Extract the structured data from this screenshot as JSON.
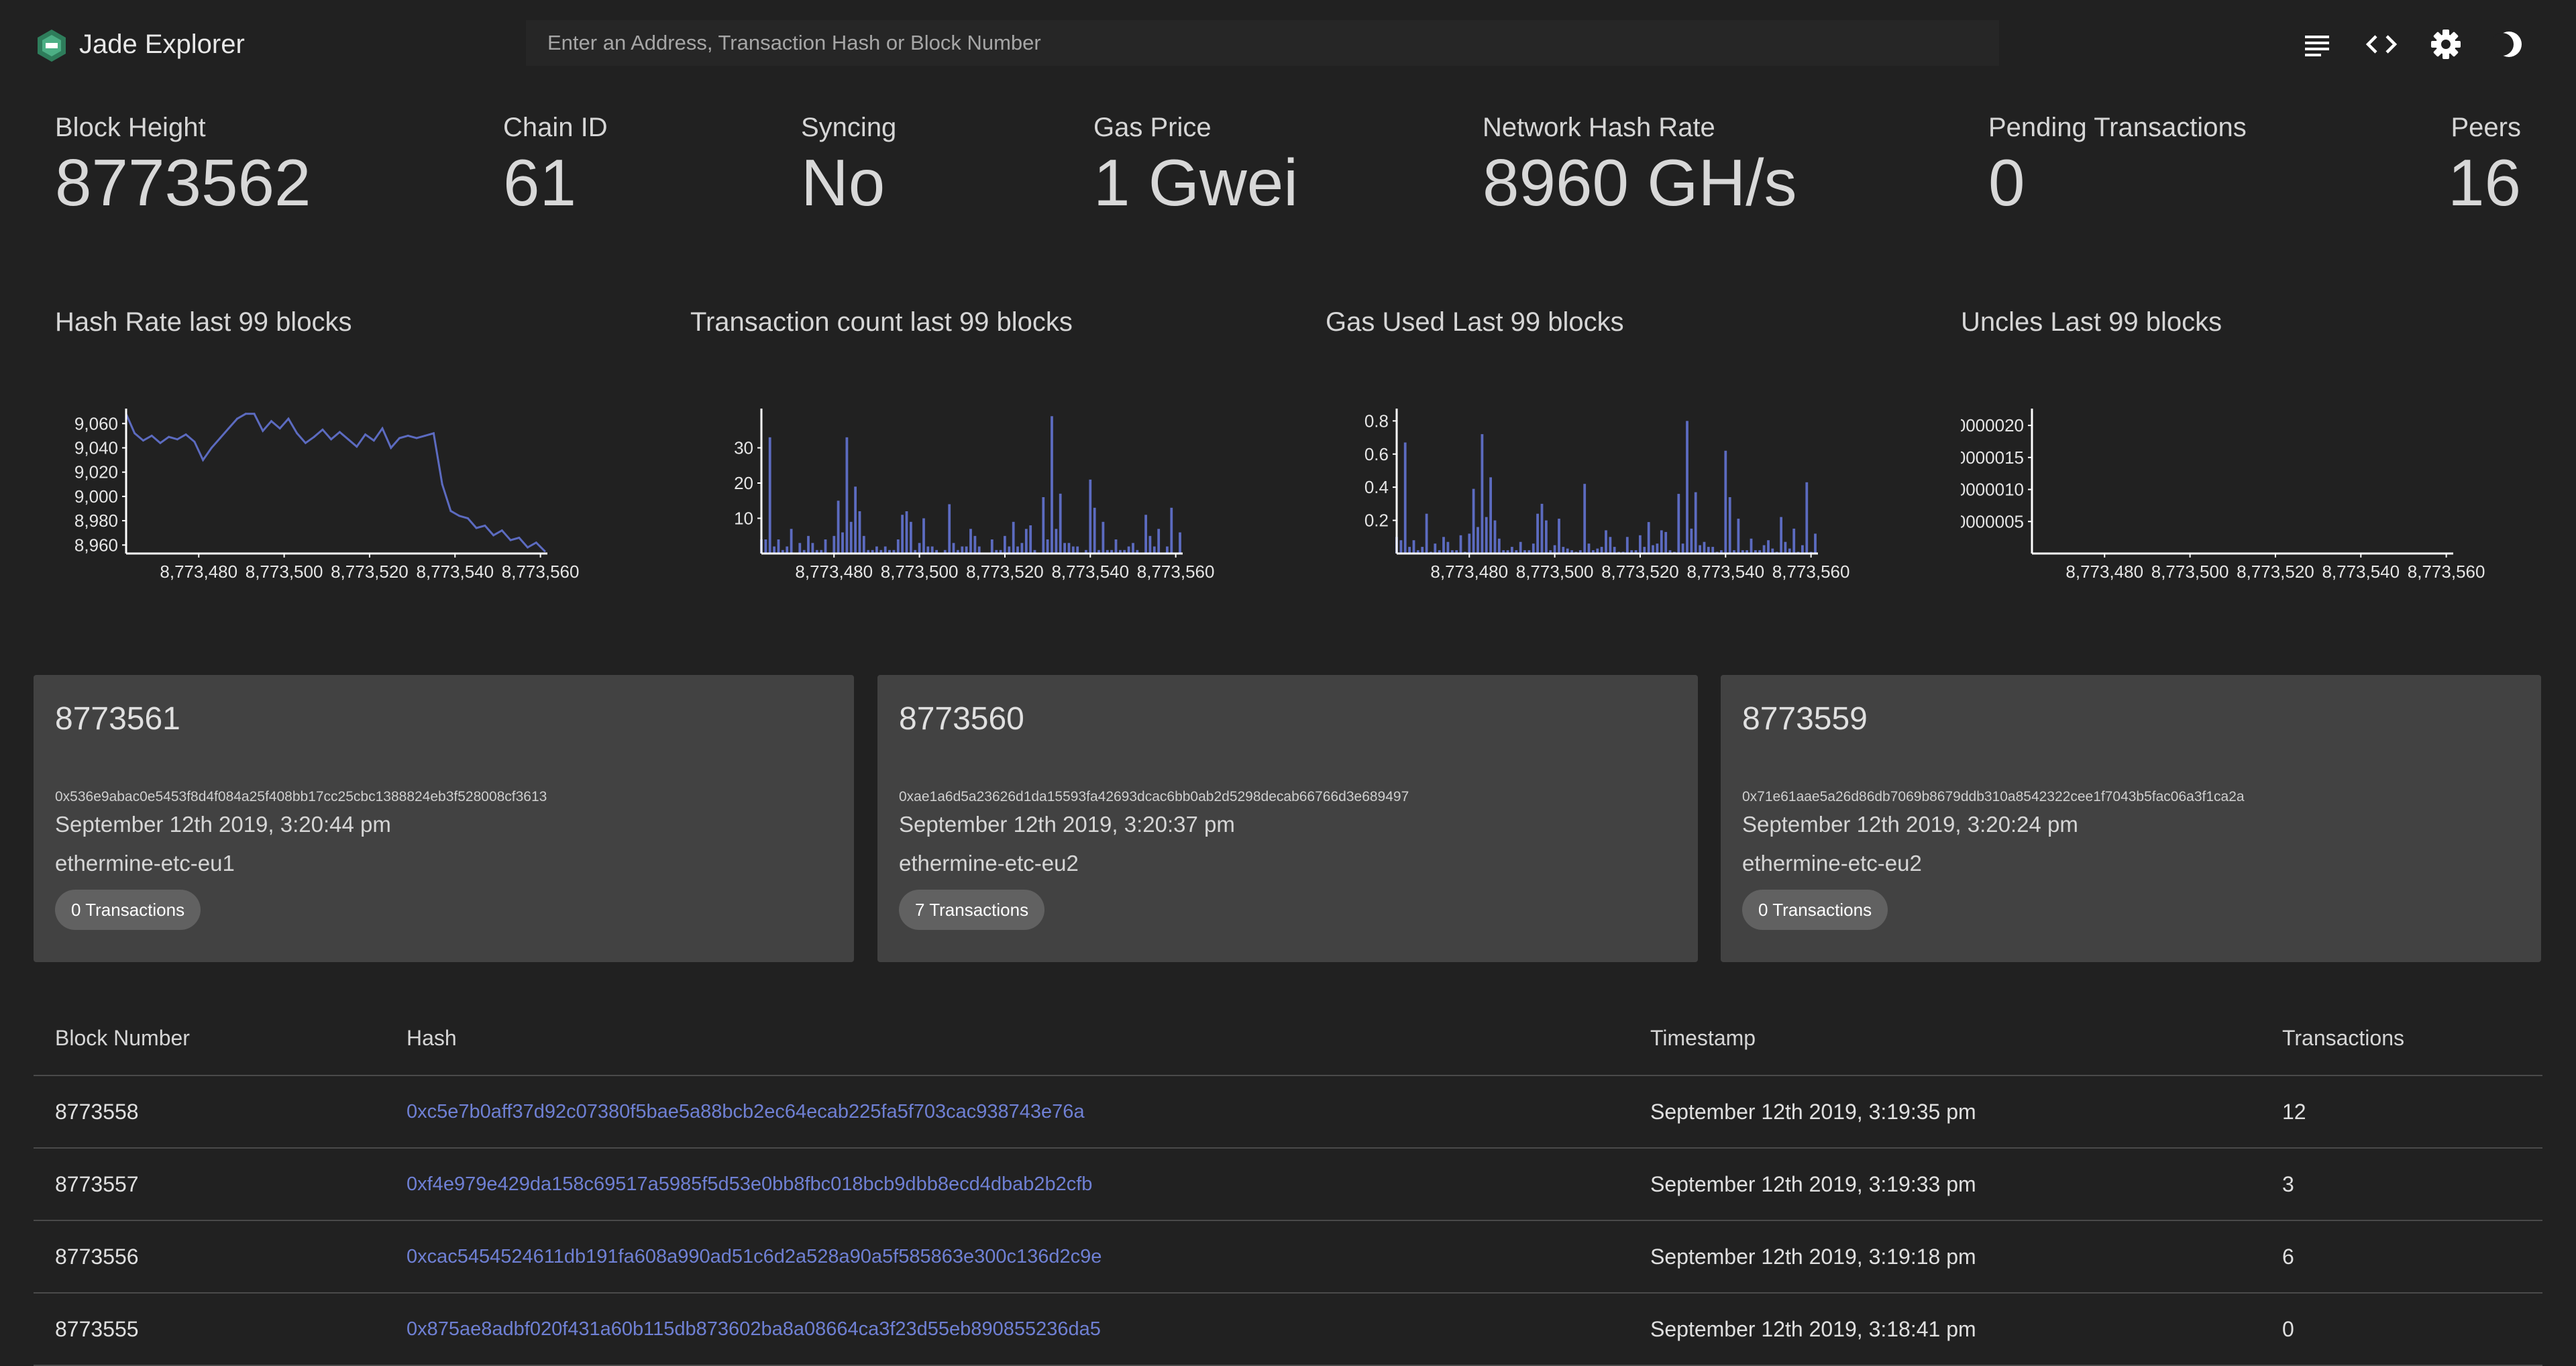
{
  "header": {
    "app_title": "Jade Explorer",
    "search_placeholder": "Enter an Address, Transaction Hash or Block Number",
    "icons": [
      "menu-icon",
      "code-icon",
      "settings-icon",
      "dark-mode-icon"
    ]
  },
  "stats": [
    {
      "label": "Block Height",
      "value": "8773562"
    },
    {
      "label": "Chain ID",
      "value": "61"
    },
    {
      "label": "Syncing",
      "value": "No"
    },
    {
      "label": "Gas Price",
      "value": "1 Gwei"
    },
    {
      "label": "Network Hash Rate",
      "value": "8960 GH/s"
    },
    {
      "label": "Pending Transactions",
      "value": "0"
    },
    {
      "label": "Peers",
      "value": "16"
    }
  ],
  "colors": {
    "accent": "#5c6bc0",
    "background": "#212121",
    "card": "#424242",
    "link": "#6f80d4"
  },
  "chart_data": [
    {
      "type": "line",
      "title": "Hash Rate last 99 blocks",
      "xlim": [
        8773463,
        8773561
      ],
      "ylim": [
        8953,
        9069
      ],
      "x_ticks": [
        "8,773,480",
        "8,773,500",
        "8,773,520",
        "8,773,540",
        "8,773,560"
      ],
      "x_tick_values": [
        8773480,
        8773500,
        8773520,
        8773540,
        8773560
      ],
      "y_ticks": [
        "8,960",
        "8,980",
        "9,000",
        "9,020",
        "9,040",
        "9,060"
      ],
      "y_tick_values": [
        8960,
        8980,
        9000,
        9020,
        9040,
        9060
      ],
      "series_color": "#5c6bc0",
      "x": [
        8773463,
        8773465,
        8773467,
        8773469,
        8773471,
        8773473,
        8773475,
        8773477,
        8773479,
        8773481,
        8773483,
        8773485,
        8773487,
        8773489,
        8773491,
        8773493,
        8773495,
        8773497,
        8773499,
        8773501,
        8773503,
        8773505,
        8773507,
        8773509,
        8773511,
        8773513,
        8773515,
        8773517,
        8773519,
        8773521,
        8773523,
        8773525,
        8773527,
        8773529,
        8773531,
        8773533,
        8773535,
        8773537,
        8773539,
        8773541,
        8773543,
        8773545,
        8773547,
        8773549,
        8773551,
        8773553,
        8773555,
        8773557,
        8773559,
        8773561
      ],
      "values": [
        9068,
        9052,
        9046,
        9050,
        9044,
        9049,
        9047,
        9051,
        9045,
        9030,
        9040,
        9048,
        9056,
        9064,
        9068,
        9068,
        9054,
        9062,
        9056,
        9064,
        9052,
        9044,
        9049,
        9055,
        9047,
        9053,
        9047,
        9041,
        9051,
        9046,
        9056,
        9040,
        9048,
        9050,
        9048,
        9050,
        9052,
        9010,
        8988,
        8984,
        8982,
        8974,
        8976,
        8968,
        8972,
        8964,
        8966,
        8958,
        8962,
        8955
      ]
    },
    {
      "type": "bar",
      "title": "Transaction count last 99 blocks",
      "xlim": [
        8773463,
        8773561
      ],
      "ylim": [
        0,
        40
      ],
      "x_ticks": [
        "8,773,480",
        "8,773,500",
        "8,773,520",
        "8,773,540",
        "8,773,560"
      ],
      "x_tick_values": [
        8773480,
        8773500,
        8773520,
        8773540,
        8773560
      ],
      "y_ticks": [
        "10",
        "20",
        "30"
      ],
      "y_tick_values": [
        10,
        20,
        30
      ],
      "series_color": "#5c6bc0",
      "x": [
        8773463,
        8773464,
        8773465,
        8773466,
        8773467,
        8773468,
        8773469,
        8773470,
        8773471,
        8773472,
        8773473,
        8773474,
        8773475,
        8773476,
        8773477,
        8773478,
        8773479,
        8773480,
        8773481,
        8773482,
        8773483,
        8773484,
        8773485,
        8773486,
        8773487,
        8773488,
        8773489,
        8773490,
        8773491,
        8773492,
        8773493,
        8773494,
        8773495,
        8773496,
        8773497,
        8773498,
        8773499,
        8773500,
        8773501,
        8773502,
        8773503,
        8773504,
        8773505,
        8773506,
        8773507,
        8773508,
        8773509,
        8773510,
        8773511,
        8773512,
        8773513,
        8773514,
        8773515,
        8773516,
        8773517,
        8773518,
        8773519,
        8773520,
        8773521,
        8773522,
        8773523,
        8773524,
        8773525,
        8773526,
        8773527,
        8773528,
        8773529,
        8773530,
        8773531,
        8773532,
        8773533,
        8773534,
        8773535,
        8773536,
        8773537,
        8773538,
        8773539,
        8773540,
        8773541,
        8773542,
        8773543,
        8773544,
        8773545,
        8773546,
        8773547,
        8773548,
        8773549,
        8773550,
        8773551,
        8773552,
        8773553,
        8773554,
        8773555,
        8773556,
        8773557,
        8773558,
        8773559,
        8773560,
        8773561
      ],
      "values": [
        4,
        4,
        33,
        2,
        4,
        1,
        2,
        7,
        0,
        3,
        1,
        5,
        3,
        1,
        1,
        4,
        0,
        5,
        15,
        6,
        33,
        9,
        19,
        12,
        5,
        1,
        1,
        2,
        1,
        2,
        1,
        1,
        4,
        11,
        12,
        9,
        1,
        3,
        10,
        2,
        2,
        1,
        0,
        1,
        14,
        3,
        1,
        2,
        2,
        7,
        5,
        2,
        0,
        0,
        4,
        1,
        1,
        5,
        2,
        9,
        2,
        3,
        7,
        8,
        1,
        0,
        16,
        4,
        39,
        7,
        17,
        3,
        3,
        2,
        2,
        0,
        1,
        21,
        13,
        1,
        9,
        1,
        1,
        4,
        1,
        1,
        2,
        3,
        1,
        0,
        11,
        5,
        2,
        7,
        0,
        2,
        13,
        0,
        6
      ]
    },
    {
      "type": "bar",
      "title": "Gas Used Last 99 blocks",
      "xlim": [
        8773463,
        8773561
      ],
      "ylim": [
        0,
        0.85
      ],
      "x_ticks": [
        "8,773,480",
        "8,773,500",
        "8,773,520",
        "8,773,540",
        "8,773,560"
      ],
      "x_tick_values": [
        8773480,
        8773500,
        8773520,
        8773540,
        8773560
      ],
      "y_ticks": [
        "0.2",
        "0.4",
        "0.6",
        "0.8"
      ],
      "y_tick_values": [
        0.2,
        0.4,
        0.6,
        0.8
      ],
      "series_color": "#5c6bc0",
      "x": [
        8773463,
        8773464,
        8773465,
        8773466,
        8773467,
        8773468,
        8773469,
        8773470,
        8773471,
        8773472,
        8773473,
        8773474,
        8773475,
        8773476,
        8773477,
        8773478,
        8773479,
        8773480,
        8773481,
        8773482,
        8773483,
        8773484,
        8773485,
        8773486,
        8773487,
        8773488,
        8773489,
        8773490,
        8773491,
        8773492,
        8773493,
        8773494,
        8773495,
        8773496,
        8773497,
        8773498,
        8773499,
        8773500,
        8773501,
        8773502,
        8773503,
        8773504,
        8773505,
        8773506,
        8773507,
        8773508,
        8773509,
        8773510,
        8773511,
        8773512,
        8773513,
        8773514,
        8773515,
        8773516,
        8773517,
        8773518,
        8773519,
        8773520,
        8773521,
        8773522,
        8773523,
        8773524,
        8773525,
        8773526,
        8773527,
        8773528,
        8773529,
        8773530,
        8773531,
        8773532,
        8773533,
        8773534,
        8773535,
        8773536,
        8773537,
        8773538,
        8773539,
        8773540,
        8773541,
        8773542,
        8773543,
        8773544,
        8773545,
        8773546,
        8773547,
        8773548,
        8773549,
        8773550,
        8773551,
        8773552,
        8773553,
        8773554,
        8773555,
        8773556,
        8773557,
        8773558,
        8773559,
        8773560,
        8773561
      ],
      "values": [
        0.1,
        0.08,
        0.67,
        0.04,
        0.08,
        0.02,
        0.04,
        0.24,
        0.01,
        0.06,
        0.02,
        0.1,
        0.07,
        0.02,
        0.02,
        0.11,
        0.01,
        0.12,
        0.39,
        0.16,
        0.72,
        0.22,
        0.46,
        0.2,
        0.09,
        0.02,
        0.02,
        0.04,
        0.02,
        0.07,
        0.02,
        0.02,
        0.06,
        0.24,
        0.3,
        0.2,
        0.02,
        0.05,
        0.21,
        0.04,
        0.03,
        0.02,
        0.01,
        0.02,
        0.42,
        0.06,
        0.02,
        0.03,
        0.04,
        0.14,
        0.1,
        0.04,
        0.01,
        0.01,
        0.1,
        0.02,
        0.02,
        0.11,
        0.04,
        0.19,
        0.05,
        0.06,
        0.14,
        0.13,
        0.02,
        0.01,
        0.36,
        0.06,
        0.8,
        0.15,
        0.37,
        0.05,
        0.07,
        0.04,
        0.04,
        0.01,
        0.02,
        0.62,
        0.34,
        0.02,
        0.21,
        0.02,
        0.02,
        0.09,
        0.02,
        0.02,
        0.05,
        0.08,
        0.03,
        0.01,
        0.22,
        0.07,
        0.03,
        0.15,
        0.01,
        0.05,
        0.43,
        0.01,
        0.12
      ]
    },
    {
      "type": "bar",
      "title": "Uncles Last 99 blocks",
      "xlim": [
        8773463,
        8773561
      ],
      "ylim": [
        0,
        2.2e-06
      ],
      "x_ticks": [
        "8,773,480",
        "8,773,500",
        "8,773,520",
        "8,773,540",
        "8,773,560"
      ],
      "x_tick_values": [
        8773480,
        8773500,
        8773520,
        8773540,
        8773560
      ],
      "y_ticks": [
        "0000005",
        "0000010",
        "0000015",
        "0000020"
      ],
      "y_tick_values": [
        5e-07,
        1e-06,
        1.5e-06,
        2e-06
      ],
      "series_color": "#5c6bc0",
      "x": [],
      "values": []
    }
  ],
  "blocks": [
    {
      "number": "8773561",
      "hash": "0x536e9abac0e5453f8d4f084a25f408bb17cc25cbc1388824eb3f528008cf3613",
      "time": "September 12th 2019, 3:20:44 pm",
      "miner": "ethermine-etc-eu1",
      "tx_label": "0 Transactions"
    },
    {
      "number": "8773560",
      "hash": "0xae1a6d5a23626d1da15593fa42693dcac6bb0ab2d5298decab66766d3e689497",
      "time": "September 12th 2019, 3:20:37 pm",
      "miner": "ethermine-etc-eu2",
      "tx_label": "7 Transactions"
    },
    {
      "number": "8773559",
      "hash": "0x71e61aae5a26d86db7069b8679ddb310a8542322cee1f7043b5fac06a3f1ca2a",
      "time": "September 12th 2019, 3:20:24 pm",
      "miner": "ethermine-etc-eu2",
      "tx_label": "0 Transactions"
    }
  ],
  "table": {
    "headers": [
      "Block Number",
      "Hash",
      "Timestamp",
      "Transactions"
    ],
    "rows": [
      {
        "number": "8773558",
        "hash": "0xc5e7b0aff37d92c07380f5bae5a88bcb2ec64ecab225fa5f703cac938743e76a",
        "timestamp": "September 12th 2019, 3:19:35 pm",
        "transactions": "12"
      },
      {
        "number": "8773557",
        "hash": "0xf4e979e429da158c69517a5985f5d53e0bb8fbc018bcb9dbb8ecd4dbab2b2cfb",
        "timestamp": "September 12th 2019, 3:19:33 pm",
        "transactions": "3"
      },
      {
        "number": "8773556",
        "hash": "0xcac5454524611db191fa608a990ad51c6d2a528a90a5f585863e300c136d2c9e",
        "timestamp": "September 12th 2019, 3:19:18 pm",
        "transactions": "6"
      },
      {
        "number": "8773555",
        "hash": "0x875ae8adbf020f431a60b115db873602ba8a08664ca3f23d55eb890855236da5",
        "timestamp": "September 12th 2019, 3:18:41 pm",
        "transactions": "0"
      }
    ]
  }
}
